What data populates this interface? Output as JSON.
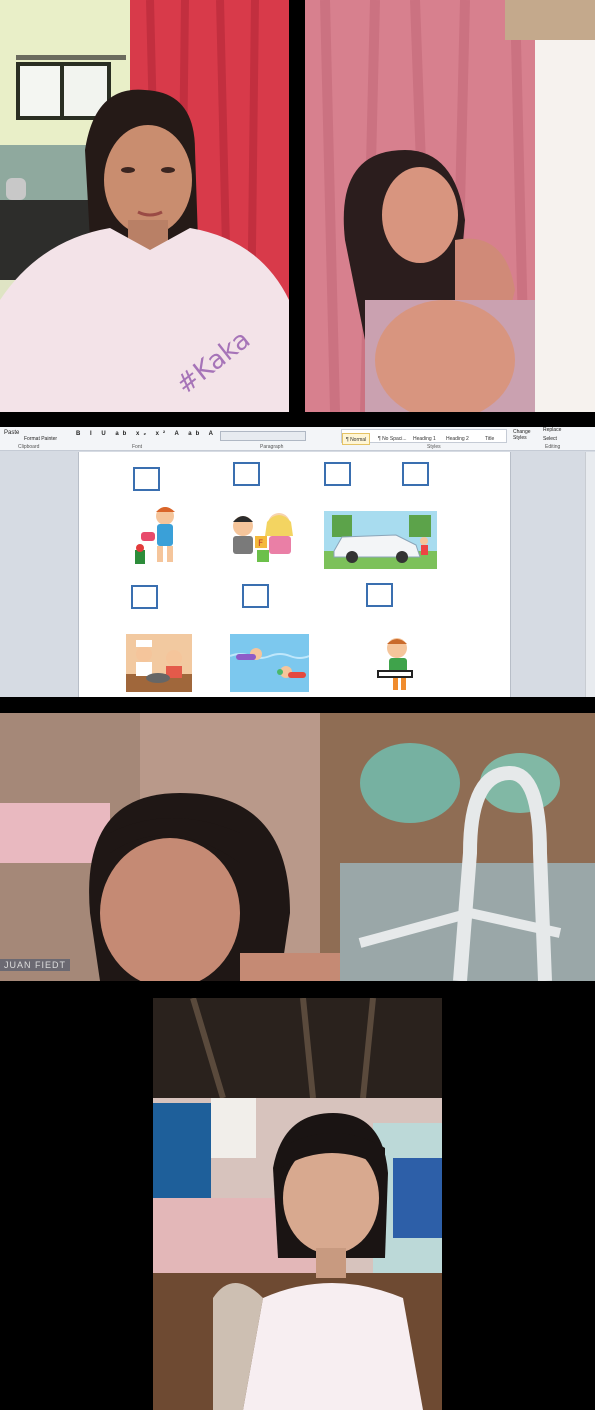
{
  "colors": {
    "background": "#000000",
    "ribbon_bg": "#f3f5f8",
    "checkbox_border": "#3a6fb0",
    "style_selected": "#fff6d5"
  },
  "participants": [
    {
      "role": "teacher",
      "icon": "video-feed-teacher"
    },
    {
      "role": "student",
      "icon": "video-feed-student-1"
    },
    {
      "role": "student",
      "icon": "video-feed-student-2",
      "caption": "JUAN FIEDT"
    },
    {
      "role": "student",
      "icon": "video-feed-student-3"
    }
  ],
  "shared_screen": {
    "app": "Microsoft Word",
    "ribbon": {
      "paste_label": "Paste",
      "format_painter_label": "Format Painter",
      "groups": {
        "clipboard": "Clipboard",
        "font": "Font",
        "paragraph": "Paragraph",
        "styles": "Styles",
        "editing": "Editing"
      },
      "styles": [
        "¶ Normal",
        "¶ No Spaci...",
        "Heading 1",
        "Heading 2",
        "Title"
      ],
      "change_styles_label": "Change Styles",
      "select_label": "Select",
      "replace_label": "Replace"
    },
    "document": {
      "row1_items": [
        "girl-watering-plant",
        "kids-playing-blocks",
        "kids-washing-car"
      ],
      "row2_items": [
        "kids-cooking",
        "kids-swimming",
        "boy-playing-keyboard"
      ]
    }
  }
}
